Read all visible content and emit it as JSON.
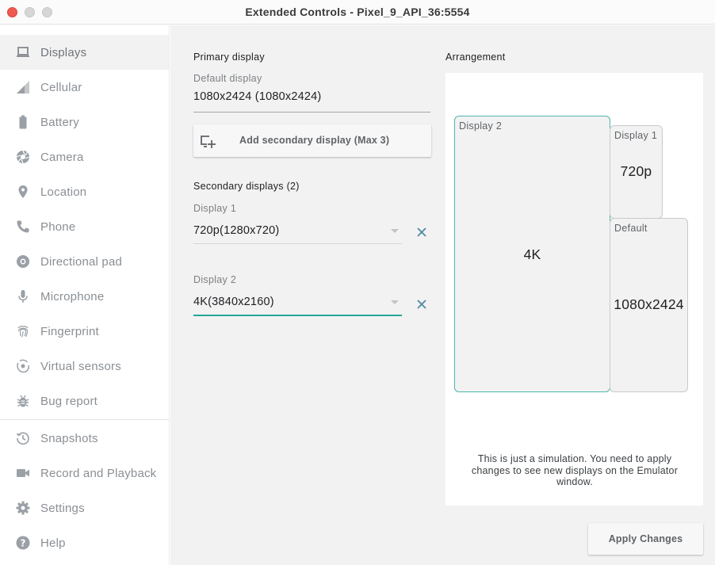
{
  "window": {
    "title": "Extended Controls - Pixel_9_API_36:5554"
  },
  "sidebar": {
    "items": [
      {
        "label": "Displays",
        "icon": "laptop-icon",
        "active": true
      },
      {
        "label": "Cellular",
        "icon": "signal-icon"
      },
      {
        "label": "Battery",
        "icon": "battery-icon"
      },
      {
        "label": "Camera",
        "icon": "camera-aperture-icon"
      },
      {
        "label": "Location",
        "icon": "location-pin-icon"
      },
      {
        "label": "Phone",
        "icon": "phone-icon"
      },
      {
        "label": "Directional pad",
        "icon": "dpad-icon"
      },
      {
        "label": "Microphone",
        "icon": "microphone-icon"
      },
      {
        "label": "Fingerprint",
        "icon": "fingerprint-icon"
      },
      {
        "label": "Virtual sensors",
        "icon": "rotation-icon"
      },
      {
        "label": "Bug report",
        "icon": "bug-icon"
      },
      {
        "label": "Snapshots",
        "icon": "history-icon"
      },
      {
        "label": "Record and Playback",
        "icon": "videocam-icon"
      },
      {
        "label": "Settings",
        "icon": "gear-icon"
      },
      {
        "label": "Help",
        "icon": "help-icon"
      }
    ]
  },
  "primary": {
    "section_title": "Primary display",
    "label": "Default display",
    "value": "1080x2424 (1080x2424)"
  },
  "add_button": {
    "label": "Add secondary display (Max 3)"
  },
  "secondary": {
    "section_title": "Secondary displays (2)",
    "displays": [
      {
        "label": "Display 1",
        "value": "720p(1280x720)"
      },
      {
        "label": "Display 2",
        "value": "4K(3840x2160)"
      }
    ]
  },
  "arrangement": {
    "title": "Arrangement",
    "boxes": {
      "display2": {
        "tag": "Display 2",
        "name": "4K"
      },
      "display1": {
        "tag": "Display 1",
        "name": "720p"
      },
      "default": {
        "tag": "Default",
        "name": "1080x2424"
      }
    },
    "note": "This is just a simulation. You need to apply changes to see new displays on the Emulator window."
  },
  "apply_button": {
    "label": "Apply Changes"
  },
  "colors": {
    "accent": "#26a69a",
    "close": "#ee5a52",
    "icon": "#9aa0a6"
  }
}
